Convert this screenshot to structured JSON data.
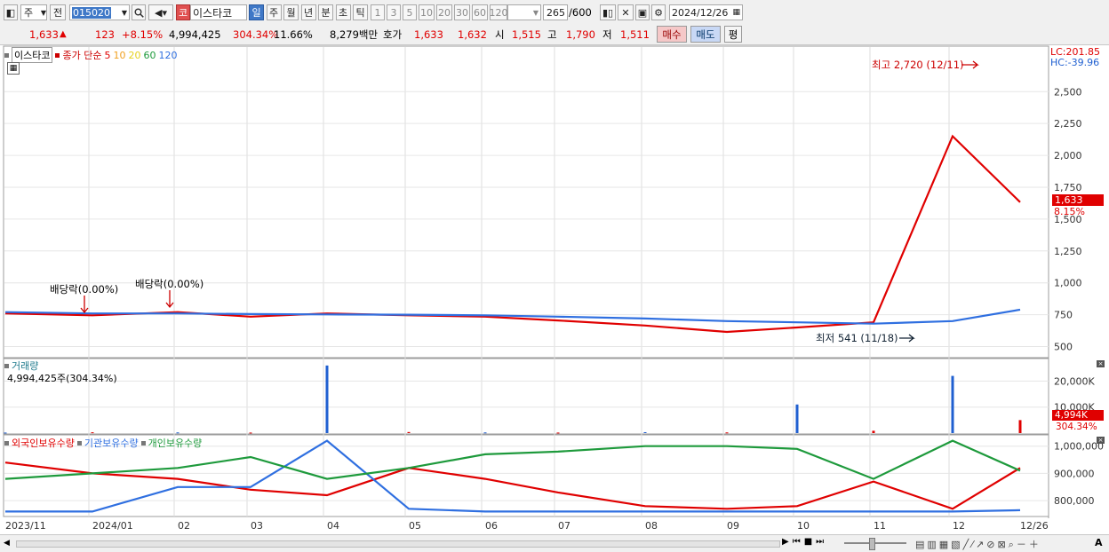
{
  "toolbar": {
    "market": "주",
    "prev_label": "전",
    "code": "015020",
    "stock_tag": "코",
    "stock_name": "이스타코",
    "periods": [
      "일",
      "주",
      "월",
      "년",
      "분",
      "초",
      "틱"
    ],
    "selected_period": "일",
    "intervals": [
      "1",
      "3",
      "5",
      "10",
      "20",
      "30",
      "60",
      "120"
    ],
    "count": "265",
    "count_total": "/600",
    "date": "2024/12/26"
  },
  "quote": {
    "price": "1,633",
    "change_arrow": "▲",
    "change": "123",
    "change_pct": "+8.15%",
    "volume": "4,994,425",
    "volume_ratio": "304.34%",
    "turnover": "11.66%",
    "amount": "8,279백만",
    "ask_label": "호가",
    "ask": "1,633",
    "bid": "1,632",
    "open_label": "시",
    "open": "1,515",
    "high_label": "고",
    "high": "1,790",
    "low_label": "저",
    "low": "1,511",
    "buy_label": "매수",
    "sell_label": "매도",
    "avg_label": "평"
  },
  "price_panel": {
    "legend_name": "이스타코",
    "legend_ma_label": "종가 단순",
    "ma_periods": [
      "5",
      "10",
      "20",
      "60",
      "120"
    ],
    "lc": "LC:201.85",
    "hc": "HC:-39.96",
    "current_price": "1,633",
    "current_pct": "8.15%",
    "high_note": "최고 2,720 (12/11)",
    "low_note": "최저 541 (11/18)",
    "dividend_note_1": "배당락(0.00%)",
    "dividend_note_2": "배당락(0.00%)",
    "y_ticks": [
      "2,500",
      "2,250",
      "2,000",
      "1,750",
      "1,500",
      "1,250",
      "1,000",
      "750",
      "500"
    ]
  },
  "volume_panel": {
    "title": "거래량",
    "value": "4,994,425주(304.34%)",
    "y_ticks": [
      "20,000K",
      "10,000K"
    ],
    "current": "4,994K",
    "current_pct": "304.34%"
  },
  "holdings_panel": {
    "foreign_label": "외국인보유수량",
    "inst_label": "기관보유수량",
    "retail_label": "개인보유수량",
    "y_ticks": [
      "1,000,000",
      "900,000",
      "800,000"
    ]
  },
  "x_axis": {
    "labels": [
      "2023/11",
      "2024/01",
      "02",
      "03",
      "04",
      "05",
      "06",
      "07",
      "08",
      "09",
      "10",
      "11",
      "12",
      "12/26"
    ]
  },
  "colors": {
    "up": "#e00000",
    "down": "#1f5fd0",
    "ma5": "#e00000",
    "ma10": "#f0a020",
    "ma20": "#f5e61e",
    "ma60": "#1e9a3c",
    "ma120": "#2f6fe0"
  },
  "chart_data": [
    {
      "type": "line",
      "name_of_panel": "price",
      "x": [
        "2023/11",
        "2024/01",
        "02",
        "03",
        "04",
        "05",
        "06",
        "07",
        "08",
        "09",
        "10",
        "11",
        "12",
        "12/26"
      ],
      "series": [
        {
          "name": "5",
          "values": [
            760,
            745,
            770,
            735,
            760,
            745,
            735,
            705,
            665,
            615,
            650,
            690,
            2150,
            1633
          ]
        },
        {
          "name": "120",
          "values": [
            770,
            760,
            760,
            755,
            752,
            750,
            745,
            735,
            720,
            700,
            690,
            680,
            700,
            790
          ]
        }
      ],
      "ylim": [
        420,
        2850
      ]
    },
    {
      "type": "bar",
      "name_of_panel": "volume",
      "categories": [
        "2023/11",
        "2024/01",
        "02",
        "03",
        "04",
        "05",
        "06",
        "07",
        "08",
        "09",
        "10",
        "11",
        "12",
        "12/26"
      ],
      "values": [
        200,
        300,
        250,
        200,
        26000,
        400,
        250,
        200,
        350,
        250,
        11000,
        900,
        22000,
        4994
      ],
      "ylim": [
        0,
        28000
      ]
    },
    {
      "type": "line",
      "name_of_panel": "holdings",
      "x": [
        "2023/11",
        "2024/01",
        "02",
        "03",
        "04",
        "05",
        "06",
        "07",
        "08",
        "09",
        "10",
        "11",
        "12",
        "12/26"
      ],
      "series": [
        {
          "name": "외국인보유수량",
          "values": [
            940,
            900,
            880,
            840,
            820,
            920,
            880,
            830,
            780,
            770,
            780,
            870,
            770,
            920
          ]
        },
        {
          "name": "기관보유수량",
          "values": [
            760,
            760,
            850,
            850,
            1020,
            770,
            760,
            760,
            760,
            760,
            760,
            760,
            760,
            765
          ]
        },
        {
          "name": "개인보유수량",
          "values": [
            880,
            900,
            920,
            960,
            880,
            920,
            970,
            980,
            1000,
            1000,
            990,
            880,
            1020,
            910
          ]
        }
      ],
      "ylim": [
        745,
        1035
      ]
    }
  ]
}
